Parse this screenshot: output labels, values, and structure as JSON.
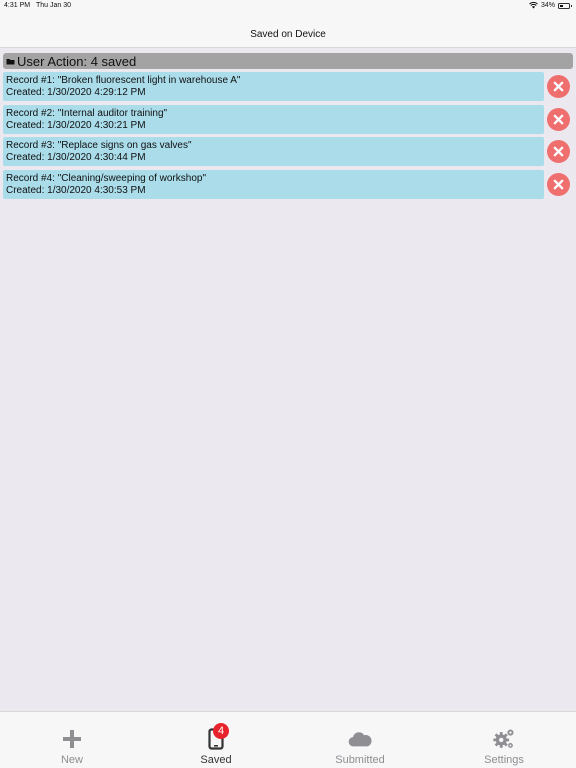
{
  "status_bar": {
    "time": "4:31 PM",
    "date": "Thu Jan 30",
    "battery": "34%",
    "battery_level": 0.34
  },
  "nav": {
    "title": "Saved on Device"
  },
  "section": {
    "title": "User Action: 4 saved",
    "icon": "folder-icon"
  },
  "records": [
    {
      "title": "Record #1: \"Broken fluorescent light in warehouse A\"",
      "created": "Created: 1/30/2020 4:29:12 PM"
    },
    {
      "title": "Record #2: \"Internal auditor training\"",
      "created": "Created: 1/30/2020 4:30:21 PM"
    },
    {
      "title": "Record #3: \"Replace signs on gas valves\"",
      "created": "Created: 1/30/2020 4:30:44 PM"
    },
    {
      "title": "Record #4: \"Cleaning/sweeping of workshop\"",
      "created": "Created: 1/30/2020 4:30:53 PM"
    }
  ],
  "tabs": [
    {
      "label": "New",
      "icon": "plus-icon",
      "active": false
    },
    {
      "label": "Saved",
      "icon": "phone-icon",
      "active": true,
      "badge": "4"
    },
    {
      "label": "Submitted",
      "icon": "cloud-icon",
      "active": false
    },
    {
      "label": "Settings",
      "icon": "gears-icon",
      "active": false
    }
  ],
  "colors": {
    "background": "#ebe9ef",
    "record_card": "#aadcea",
    "delete_button": "#ef6f6f",
    "section_header": "#a3a3a3",
    "badge": "#e8232b",
    "tab_inactive": "#8e8e93"
  }
}
